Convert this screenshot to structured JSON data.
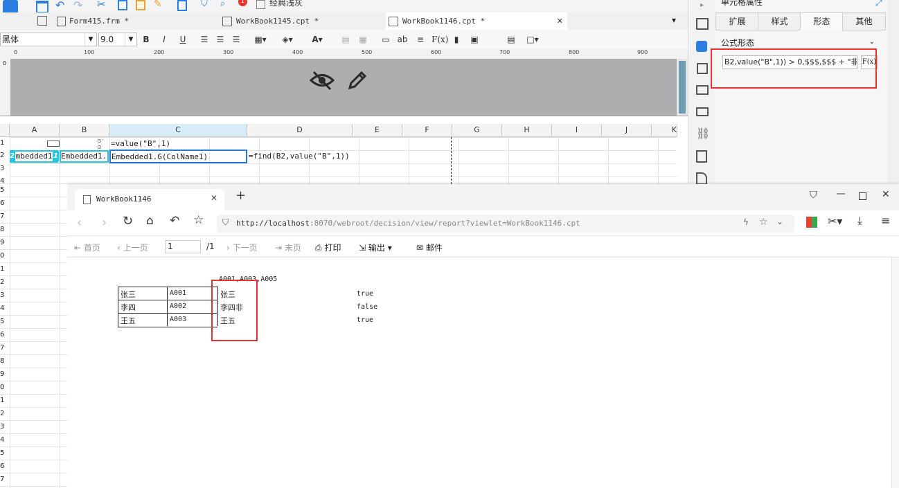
{
  "toolbar": {
    "badge_count": "1",
    "theme_label": "经典浅灰"
  },
  "tabs": [
    {
      "label": "Form415.frm *"
    },
    {
      "label": "WorkBook1145.cpt *"
    },
    {
      "label": "WorkBook1146.cpt *"
    }
  ],
  "format": {
    "font_name": "黑体",
    "font_size": "9.0",
    "bold": "B",
    "italic": "I",
    "underline": "U",
    "formula_btn": "F(x)",
    "ab_label": "ab"
  },
  "ruler": {
    "marks": [
      "0",
      "100",
      "200",
      "300",
      "400",
      "500",
      "600",
      "700",
      "800",
      "900"
    ],
    "v_mark": "0"
  },
  "sheet": {
    "columns": [
      "A",
      "B",
      "C",
      "D",
      "E",
      "F",
      "G",
      "H",
      "I",
      "J",
      "K"
    ],
    "row_numbers": [
      "1",
      "2",
      "3",
      "4",
      "5",
      "6",
      "7",
      "8",
      "9",
      "0",
      "1",
      "2",
      "3",
      "4",
      "5",
      "6",
      "7",
      "8",
      "9",
      "0",
      "1",
      "2",
      "3",
      "4",
      "5",
      "6",
      "7"
    ],
    "cells": {
      "c1": "=value(\"B\",1)",
      "a2": "Embedded1.",
      "b2": "Embedded1.",
      "c2": "Embedded1.G(ColName1)",
      "d2": "=find(B2,value(\"B\",1)) >",
      "a2_marker": "2",
      "b2_marker": "1"
    }
  },
  "panel": {
    "title": "单元格属性",
    "tabs": [
      "扩展",
      "样式",
      "形态",
      "其他"
    ],
    "active_tab": "形态",
    "form_type": "公式形态",
    "formula": "B2,value(\"B\",1)) > 0,$$$,$$$ + \"非\")",
    "fx_label": "F(x)"
  },
  "browser": {
    "tab_title": "WorkBook1146",
    "url_host": "http://localhost",
    "url_rest": ":8070/webroot/decision/view/report?viewlet=WorkBook1146.cpt"
  },
  "report_toolbar": {
    "first": "首页",
    "prev": "上一页",
    "page": "1",
    "total": "/1",
    "next": "下一页",
    "last": "末页",
    "print": "打印",
    "export": "输出",
    "mail": "邮件"
  },
  "report": {
    "header_value": "A001,A003,A005",
    "rows": [
      {
        "name": "张三",
        "code": "A001",
        "display": "张三",
        "flag": "true"
      },
      {
        "name": "李四",
        "code": "A002",
        "display": "李四非",
        "flag": "false"
      },
      {
        "name": "王五",
        "code": "A003",
        "display": "王五",
        "flag": "true"
      }
    ]
  },
  "colors": {
    "highlight_red": "#e23232",
    "selection_blue": "#1e7ad6",
    "marker_cyan": "#1ec8e6"
  }
}
